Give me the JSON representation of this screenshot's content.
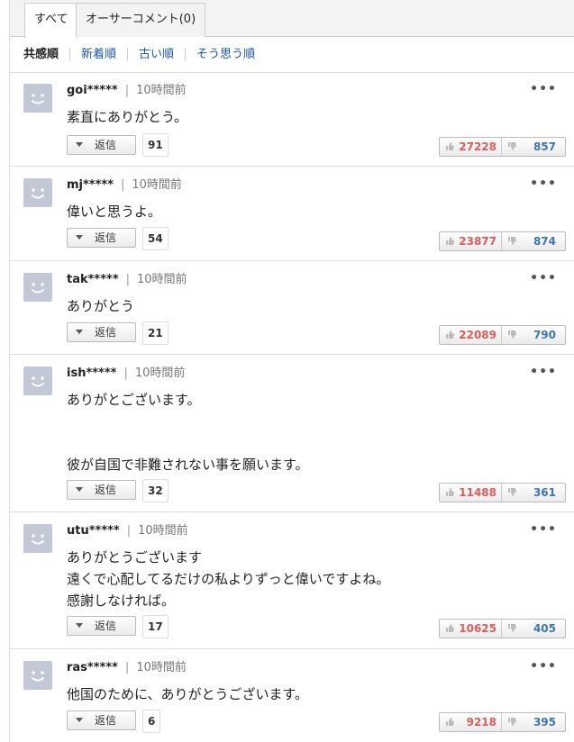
{
  "tabs": [
    {
      "label": "すべて",
      "active": true
    },
    {
      "label": "オーサーコメント(0)",
      "active": false
    }
  ],
  "sort": [
    "共感順",
    "新着順",
    "古い順",
    "そう思う順"
  ],
  "reply_label": "返信",
  "comments": [
    {
      "user": "goi*****",
      "time": "10時間前",
      "text": "素直にありがとう。",
      "replies": "91",
      "likes": "27228",
      "dislikes": "857"
    },
    {
      "user": "mj*****",
      "time": "10時間前",
      "text": "偉いと思うよ。",
      "replies": "54",
      "likes": "23877",
      "dislikes": "874"
    },
    {
      "user": "tak*****",
      "time": "10時間前",
      "text": "ありがとう",
      "replies": "21",
      "likes": "22089",
      "dislikes": "790"
    },
    {
      "user": "ish*****",
      "time": "10時間前",
      "text": "ありがとございます。\n\n\n彼が自国で非難されない事を願います。",
      "replies": "32",
      "likes": "11488",
      "dislikes": "361"
    },
    {
      "user": "utu*****",
      "time": "10時間前",
      "text": "ありがとうございます\n遠くで心配してるだけの私よりずっと偉いですよね。\n感謝しなければ。",
      "replies": "17",
      "likes": "10625",
      "dislikes": "405"
    },
    {
      "user": "ras*****",
      "time": "10時間前",
      "text": "他国のために、ありがとうございます。",
      "replies": "6",
      "likes": "9218",
      "dislikes": "395"
    }
  ]
}
